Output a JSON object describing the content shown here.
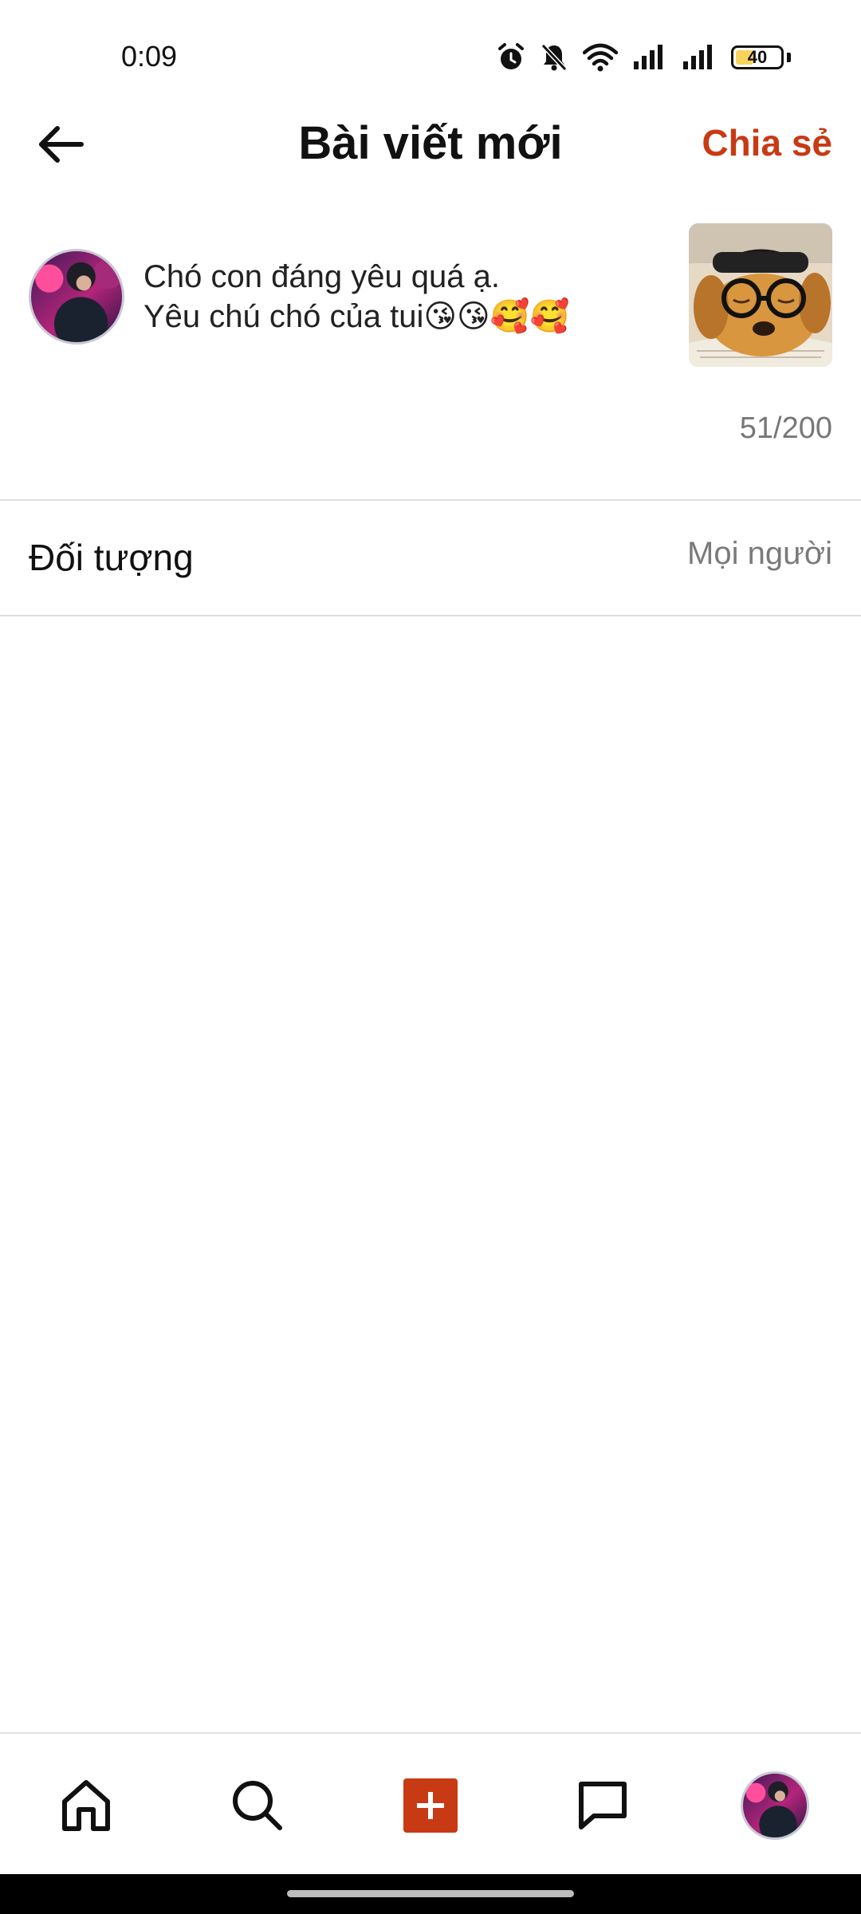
{
  "status_bar": {
    "time": "0:09",
    "battery": "40",
    "battery_level": 0.4,
    "icons": [
      "alarm-icon",
      "bell-off-icon",
      "wifi-icon",
      "signal-icon",
      "signal-icon",
      "battery-icon"
    ]
  },
  "header": {
    "title": "Bài viết mới",
    "share_label": "Chia sẻ"
  },
  "compose": {
    "caption_line1": "Chó con đáng yêu quá ạ.",
    "caption_line2": "Yêu chú chó của tui😘😘🥰🥰",
    "image": "puppy-with-glasses-image",
    "counter": "51/200"
  },
  "audience": {
    "label": "Đối tượng",
    "value": "Mọi người"
  },
  "bottom_nav": {
    "items": [
      "home-icon",
      "search-icon",
      "add-post-icon",
      "messages-icon",
      "profile-avatar"
    ]
  },
  "colors": {
    "accent": "#c83a13",
    "text": "#111111",
    "muted": "#7a7a7a",
    "divider": "#dcdcdc"
  }
}
